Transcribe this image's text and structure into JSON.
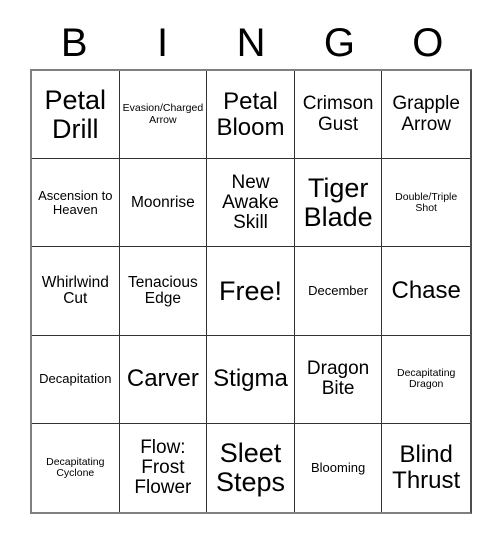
{
  "header": {
    "letters": [
      "B",
      "I",
      "N",
      "G",
      "O"
    ]
  },
  "grid": {
    "columns": 5,
    "rows": 5,
    "free_space_label": "Free!",
    "cells": [
      [
        {
          "label": "Petal Drill",
          "size": "xl"
        },
        {
          "label": "Evasion/Charged Arrow",
          "size": "xxs"
        },
        {
          "label": "Petal Bloom",
          "size": "lg"
        },
        {
          "label": "Crimson Gust",
          "size": "md"
        },
        {
          "label": "Grapple Arrow",
          "size": "md"
        }
      ],
      [
        {
          "label": "Ascension to Heaven",
          "size": "xs"
        },
        {
          "label": "Moonrise",
          "size": "sm"
        },
        {
          "label": "New Awake Skill",
          "size": "md"
        },
        {
          "label": "Tiger Blade",
          "size": "xl"
        },
        {
          "label": "Double/Triple Shot",
          "size": "xxs"
        }
      ],
      [
        {
          "label": "Whirlwind Cut",
          "size": "sm"
        },
        {
          "label": "Tenacious Edge",
          "size": "sm"
        },
        {
          "label": "Free!",
          "size": "xl"
        },
        {
          "label": "December",
          "size": "xs"
        },
        {
          "label": "Chase",
          "size": "lg"
        }
      ],
      [
        {
          "label": "Decapitation",
          "size": "xs"
        },
        {
          "label": "Carver",
          "size": "lg"
        },
        {
          "label": "Stigma",
          "size": "lg"
        },
        {
          "label": "Dragon Bite",
          "size": "md"
        },
        {
          "label": "Decapitating Dragon",
          "size": "xxs"
        }
      ],
      [
        {
          "label": "Decapitating Cyclone",
          "size": "xxs"
        },
        {
          "label": "Flow: Frost Flower",
          "size": "md"
        },
        {
          "label": "Sleet Steps",
          "size": "xl"
        },
        {
          "label": "Blooming",
          "size": "xs"
        },
        {
          "label": "Blind Thrust",
          "size": "lg"
        }
      ]
    ]
  },
  "colors": {
    "background": "#ffffff",
    "text": "#000000",
    "grid_line": "#333333",
    "grid_border": "#808080"
  }
}
